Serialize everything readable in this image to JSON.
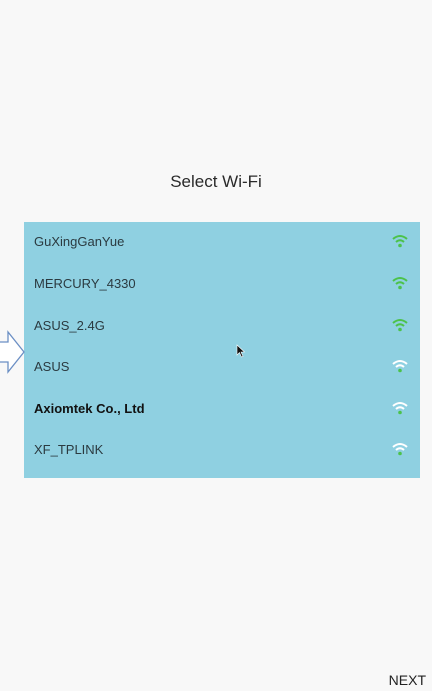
{
  "screen": {
    "title": "Select Wi-Fi",
    "next_label": "NEXT"
  },
  "wifi": {
    "networks": [
      {
        "ssid": "GuXingGanYue",
        "signal_icon": "wifi-strong-icon",
        "signal_color": "#4cc24a"
      },
      {
        "ssid": "MERCURY_4330",
        "signal_icon": "wifi-strong-icon",
        "signal_color": "#4cc24a"
      },
      {
        "ssid": "ASUS_2.4G",
        "signal_icon": "wifi-strong-icon",
        "signal_color": "#4cc24a"
      },
      {
        "ssid": "ASUS",
        "signal_icon": "wifi-weak-icon",
        "signal_color": "#ffffff"
      },
      {
        "ssid": "Axiomtek Co., Ltd",
        "signal_icon": "wifi-weak-icon",
        "signal_color": "#ffffff"
      },
      {
        "ssid": "XF_TPLINK",
        "signal_icon": "wifi-weak-icon",
        "signal_color": "#ffffff"
      }
    ]
  },
  "colors": {
    "panel_bg": "#8fd0e1",
    "screen_bg": "#f8f8f8",
    "signal_green": "#4cc24a",
    "arrow_outline": "#6b8fc4"
  }
}
